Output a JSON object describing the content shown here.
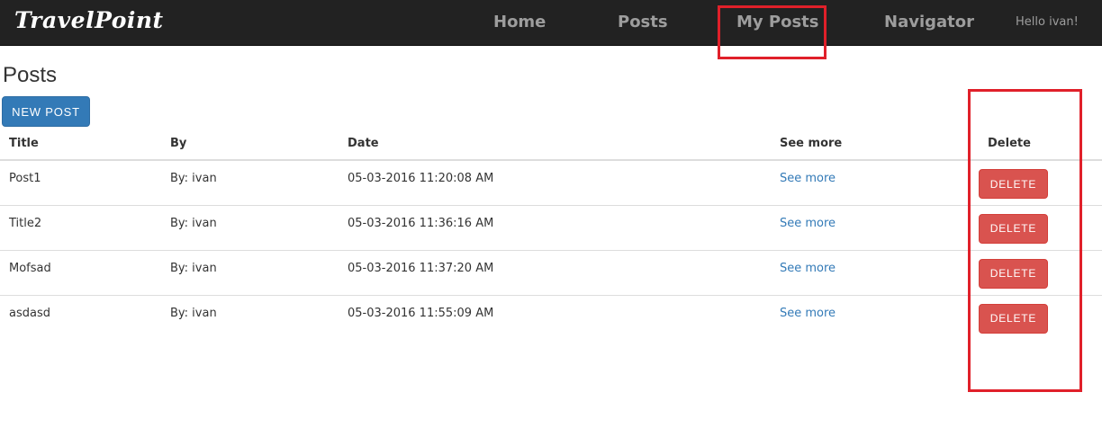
{
  "navbar": {
    "brand": "TravelPoint",
    "links": [
      {
        "label": "Home"
      },
      {
        "label": "Posts"
      },
      {
        "label": "My Posts"
      },
      {
        "label": "Navigator"
      }
    ],
    "greeting": "Hello ivan!"
  },
  "main": {
    "title": "Posts",
    "new_post_label": "NEW POST",
    "table": {
      "headers": [
        "Title",
        "By",
        "Date",
        "See more",
        "Delete"
      ],
      "rows": [
        {
          "title": "Post1",
          "by": "By: ivan",
          "date": "05-03-2016 11:20:08 AM",
          "see_more": "See more",
          "delete": "DELETE"
        },
        {
          "title": "Title2",
          "by": "By: ivan",
          "date": "05-03-2016 11:36:16 AM",
          "see_more": "See more",
          "delete": "DELETE"
        },
        {
          "title": "Mofsad",
          "by": "By: ivan",
          "date": "05-03-2016 11:37:20 AM",
          "see_more": "See more",
          "delete": "DELETE"
        },
        {
          "title": "asdasd",
          "by": "By: ivan",
          "date": "05-03-2016 11:55:09 AM",
          "see_more": "See more",
          "delete": "DELETE"
        }
      ]
    }
  },
  "colors": {
    "navbar_bg": "#222222",
    "primary": "#337ab7",
    "danger": "#d9534f",
    "highlight": "#e0202a"
  }
}
